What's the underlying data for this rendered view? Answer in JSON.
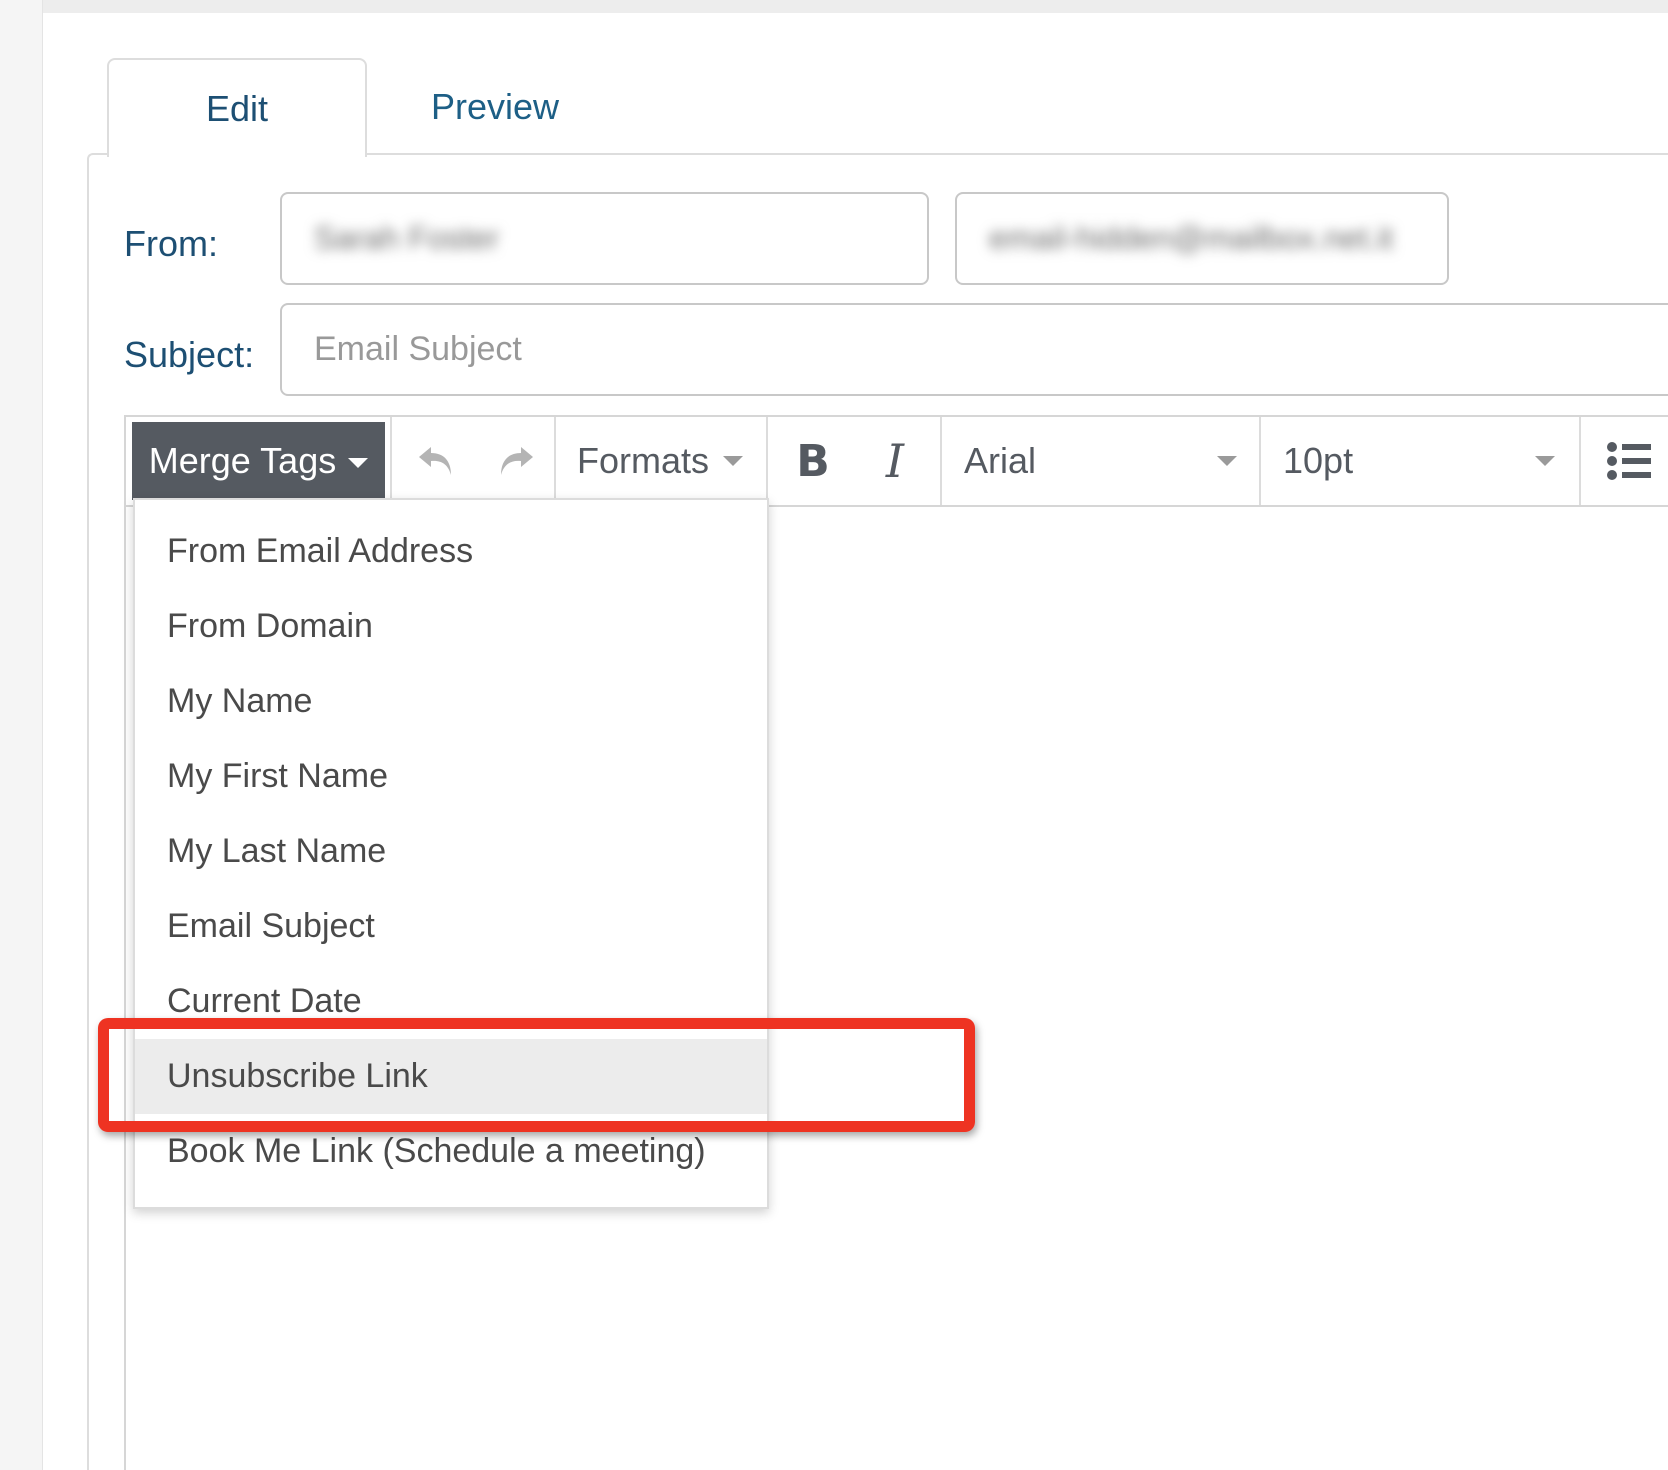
{
  "tabs": {
    "edit": "Edit",
    "preview": "Preview"
  },
  "form": {
    "from_label": "From:",
    "from_name_value": "Sarah Foster",
    "from_email_value": "email-hidden@mailbox.net.it",
    "subject_label": "Subject:",
    "subject_placeholder": "Email Subject"
  },
  "toolbar": {
    "merge_tags_label": "Merge Tags",
    "formats_label": "Formats",
    "bold_label": "B",
    "italic_label": "I",
    "font_value": "Arial",
    "size_value": "10pt",
    "icons": [
      "undo-icon",
      "redo-icon",
      "bullet-list-icon"
    ]
  },
  "merge_tags_menu": {
    "items": [
      "From Email Address",
      "From Domain",
      "My Name",
      "My First Name",
      "My Last Name",
      "Email Subject",
      "Current Date",
      "Unsubscribe Link",
      "Book Me Link (Schedule a meeting)"
    ],
    "highlighted": "Unsubscribe Link"
  },
  "colors": {
    "accent_text": "#1d4f73",
    "merge_button_bg": "#555a61",
    "annotation_red": "#ee3322",
    "highlight_bg": "#ececec"
  }
}
